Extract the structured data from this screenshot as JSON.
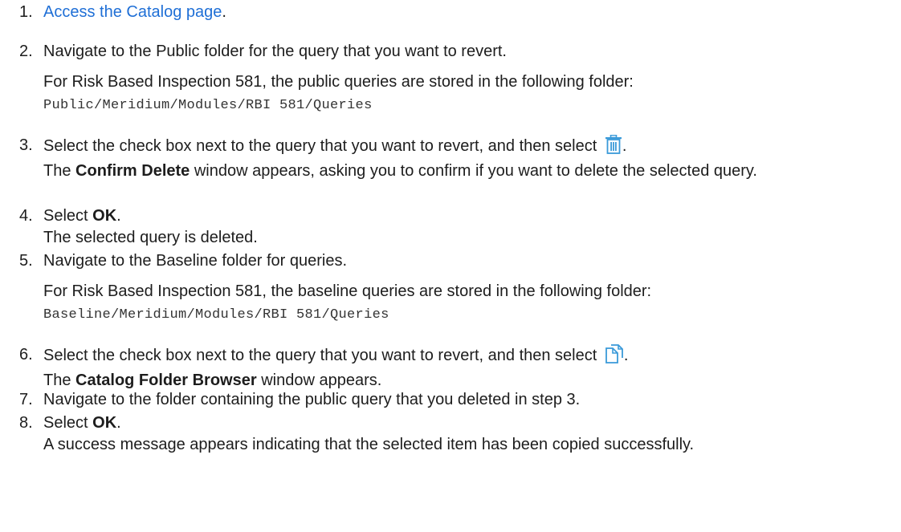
{
  "steps": [
    {
      "num": "1.",
      "link": "Access the Catalog page",
      "after": "."
    },
    {
      "num": "2.",
      "text": "Navigate to the Public folder for the query that you want to revert.",
      "note": "For Risk Based Inspection 581, the public queries are stored in the following folder:",
      "path": "Public/Meridium/Modules/RBI 581/Queries"
    },
    {
      "num": "3.",
      "text": "Select the check box next to the query that you want to revert, and then select",
      "icon": "delete-trash-icon",
      "after": ".",
      "result_bold": "Confirm Delete",
      "result_rest": " window appears, asking you to confirm if you want to delete the selected query.",
      "result_the": "The "
    },
    {
      "num": "4.",
      "text_pre": "Select ",
      "bold": "OK",
      "after": ".",
      "result": "The selected query is deleted."
    },
    {
      "num": "5.",
      "text": "Navigate to the Baseline folder for queries.",
      "note": "For Risk Based Inspection 581, the baseline queries are stored in the following folder:",
      "path": "Baseline/Meridium/Modules/RBI 581/Queries"
    },
    {
      "num": "6.",
      "text": "Select the check box next to the query that you want to revert, and then select",
      "icon": "copy-document-icon",
      "after": ".",
      "result_the": "The ",
      "result_bold": "Catalog Folder Browser",
      "result_rest": " window appears."
    },
    {
      "num": "7.",
      "text": "Navigate to the folder containing the public query that you deleted in step 3."
    },
    {
      "num": "8.",
      "text_pre": "Select ",
      "bold": "OK",
      "after": ".",
      "result": "A success message appears indicating that the selected item has been copied successfully."
    }
  ],
  "colors": {
    "link": "#1f6fd6",
    "icon": "#3a9ad9",
    "text": "#1d1d1d",
    "code": "#333333"
  }
}
